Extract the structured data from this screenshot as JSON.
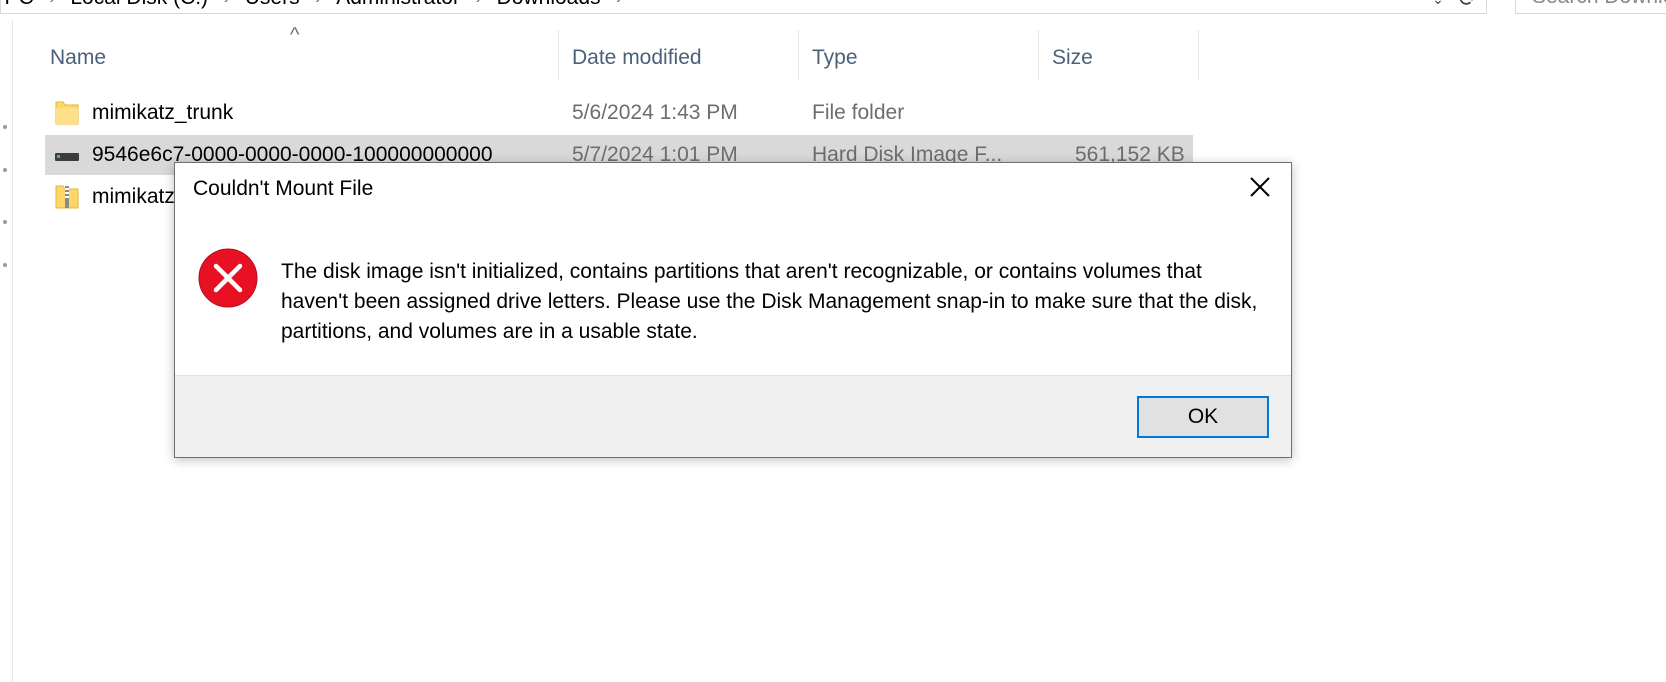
{
  "address_bar": {
    "crumbs": [
      "This PC",
      "Local Disk (C:)",
      "Users",
      "Administrator",
      "Downloads"
    ],
    "search_placeholder": "Search Downloads"
  },
  "columns": {
    "name": "Name",
    "date_modified": "Date modified",
    "type": "Type",
    "size": "Size"
  },
  "files": [
    {
      "name": "mimikatz_trunk",
      "date": "5/6/2024 1:43 PM",
      "type": "File folder",
      "size": "",
      "icon": "folder-icon"
    },
    {
      "name": "9546e6c7-0000-0000-0000-100000000000",
      "date": "5/7/2024 1:01 PM",
      "type": "Hard Disk Image F...",
      "size": "561,152 KB",
      "icon": "disk-image-icon"
    },
    {
      "name": "mimikatz_trunk",
      "date": "",
      "type": "",
      "size": "",
      "icon": "zip-folder-icon"
    }
  ],
  "dialog": {
    "title": "Couldn't Mount File",
    "message": "The disk image isn't initialized, contains partitions that aren't recognizable, or contains volumes that haven't been assigned drive letters. Please use the Disk Management snap-in to make sure that the disk, partitions, and volumes are in a usable state.",
    "ok_label": "OK",
    "icon": "error-icon"
  },
  "colors": {
    "selection": "#d9d9d9",
    "header_text": "#4c607a",
    "error_red": "#e81123",
    "button_focus": "#0078d7",
    "folder_yellow": "#ffd766"
  }
}
